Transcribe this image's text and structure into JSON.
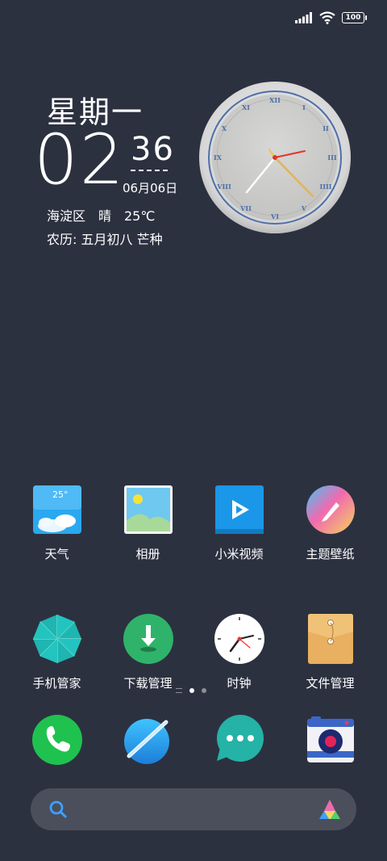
{
  "status_bar": {
    "battery": "100"
  },
  "clock_widget": {
    "weekday": "星期一",
    "hours": "02",
    "minutes": "36",
    "date": "06月06日",
    "weather": "海淀区　晴　25℃",
    "lunar": "农历: 五月初八 芒种"
  },
  "weather_icon_temp": "25°",
  "apps": [
    {
      "label": "天气"
    },
    {
      "label": "相册"
    },
    {
      "label": "小米视频"
    },
    {
      "label": "主题壁纸"
    },
    {
      "label": "手机管家"
    },
    {
      "label": "下载管理"
    },
    {
      "label": "时钟"
    },
    {
      "label": "文件管理"
    }
  ],
  "dock": [
    "phone-icon",
    "browser-icon",
    "messages-icon",
    "camera-icon"
  ],
  "page_indicator": {
    "pages": 2,
    "current": 1
  },
  "colors": {
    "background": "#2c3140",
    "search_bar": "#4a4f5b"
  }
}
